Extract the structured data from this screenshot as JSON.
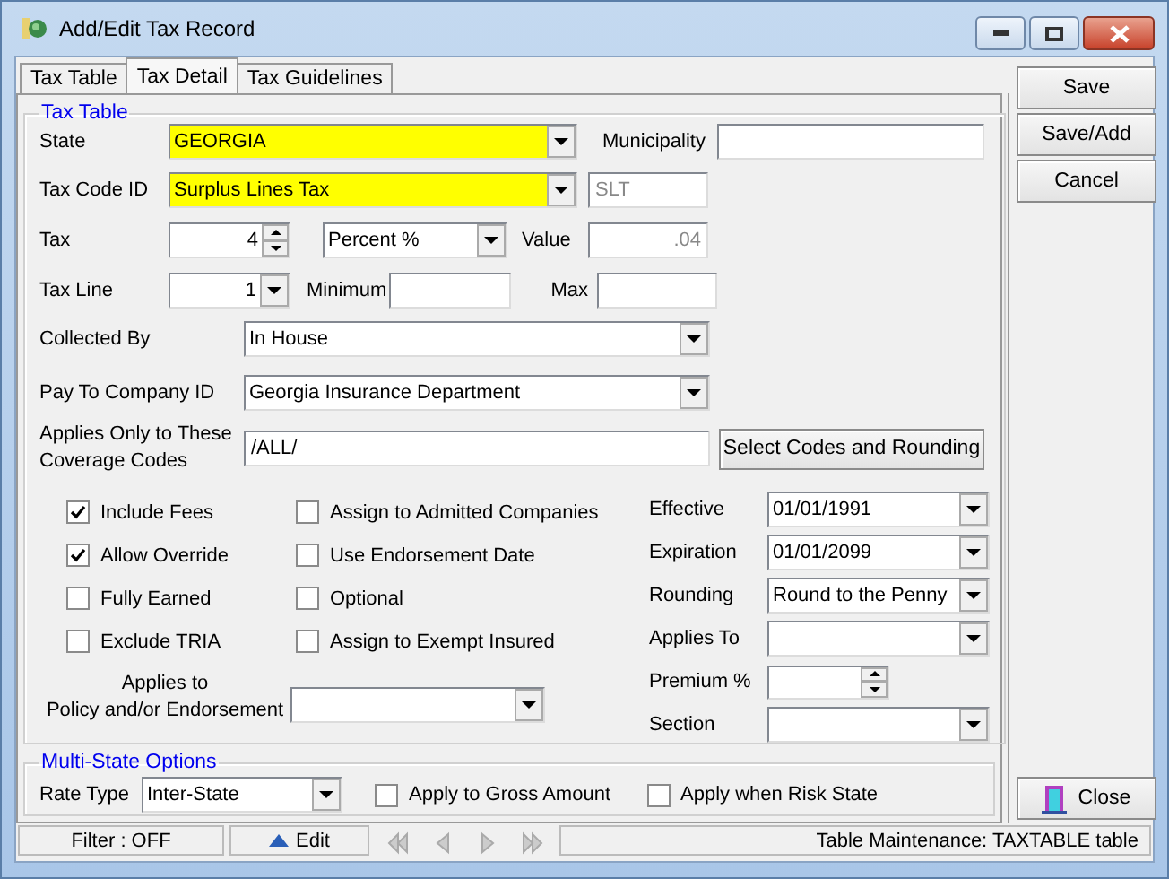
{
  "window": {
    "title": "Add/Edit Tax Record"
  },
  "tabs": [
    {
      "label": "Tax Table",
      "selected": false
    },
    {
      "label": "Tax Detail",
      "selected": true
    },
    {
      "label": "Tax Guidelines",
      "selected": false
    }
  ],
  "tax_table": {
    "title": "Tax Table",
    "state": {
      "label": "State",
      "value": "GEORGIA",
      "required": true
    },
    "municipality": {
      "label": "Municipality"
    },
    "tax_code_id": {
      "label": "Tax Code ID",
      "value": "Surplus Lines Tax",
      "required": true,
      "code": "SLT"
    },
    "tax": {
      "label": "Tax",
      "value": "4",
      "unit": "Percent %"
    },
    "value": {
      "label": "Value",
      "value": ".04"
    },
    "tax_line": {
      "label": "Tax Line",
      "value": "1"
    },
    "minimum": {
      "label": "Minimum"
    },
    "max": {
      "label": "Max"
    },
    "collected_by": {
      "label": "Collected By",
      "value": "In House"
    },
    "pay_to_company_id": {
      "label": "Pay To Company ID",
      "value": "Georgia Insurance Department"
    },
    "coverage_codes": {
      "label_lines": [
        "Applies Only to These",
        "Coverage Codes"
      ],
      "value": "/ALL/",
      "button": "Select Codes and Rounding"
    },
    "checkbox_columns": [
      [
        {
          "label": "Include Fees",
          "checked": true
        },
        {
          "label": "Allow Override",
          "checked": true
        },
        {
          "label": "Fully Earned",
          "checked": false
        },
        {
          "label": "Exclude TRIA",
          "checked": false
        }
      ],
      [
        {
          "label": "Assign to Admitted Companies",
          "checked": false
        },
        {
          "label": "Use Endorsement Date",
          "checked": false
        },
        {
          "label": "Optional",
          "checked": false
        },
        {
          "label": "Assign to Exempt Insured",
          "checked": false
        }
      ]
    ],
    "applies_to_policy": {
      "label_lines": [
        "Applies to",
        "Policy and/or Endorsement"
      ]
    },
    "side_fields": [
      {
        "label": "Effective",
        "value": "01/01/1991",
        "kind": "combo"
      },
      {
        "label": "Expiration",
        "value": "01/01/2099",
        "kind": "combo"
      },
      {
        "label": "Rounding",
        "value": "Round to the Penny",
        "kind": "combo"
      },
      {
        "label": "Applies To",
        "kind": "combo"
      },
      {
        "label": "Premium %",
        "kind": "spinner"
      },
      {
        "label": "Section",
        "kind": "combo"
      }
    ]
  },
  "multi_state": {
    "title": "Multi-State Options",
    "rate_type": {
      "label": "Rate Type",
      "value": "Inter-State"
    },
    "checkboxes": [
      {
        "label": "Apply to Gross Amount",
        "checked": false
      },
      {
        "label": "Apply when Risk State",
        "checked": false
      }
    ]
  },
  "buttons": [
    "Save",
    "Save/Add",
    "Cancel"
  ],
  "close_button": "Close",
  "status_bar": {
    "filter": "Filter : OFF",
    "edit": "Edit",
    "info": "Table Maintenance:  TAXTABLE table"
  }
}
